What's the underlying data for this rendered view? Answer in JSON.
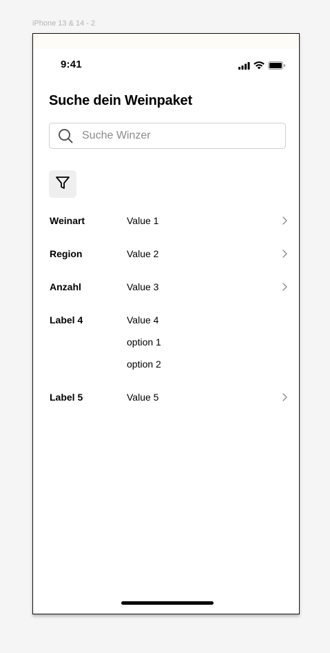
{
  "frame": {
    "title": "iPhone 13 & 14 - 2"
  },
  "status_bar": {
    "time": "9:41"
  },
  "header": {
    "title": "Suche dein Weinpaket"
  },
  "search": {
    "placeholder": "Suche Winzer",
    "value": ""
  },
  "filter": {
    "icon": "filter-icon"
  },
  "rows": [
    {
      "label": "Weinart",
      "value": "Value 1",
      "icon": "chevron-right-icon"
    },
    {
      "label": "Region",
      "value": "Value 2",
      "icon": "chevron-right-icon"
    },
    {
      "label": "Anzahl",
      "value": "Value 3",
      "icon": "chevron-right-icon"
    },
    {
      "label": "Label 4",
      "value": "Value 4",
      "options": [
        "option 1",
        "option 2"
      ]
    },
    {
      "label": "Label 5",
      "value": "Value 5",
      "icon": "chevron-right-icon"
    }
  ],
  "colors": {
    "chevron": "#8a8a8a",
    "search_border": "#cfcfcf",
    "filter_bg": "#efefef"
  }
}
